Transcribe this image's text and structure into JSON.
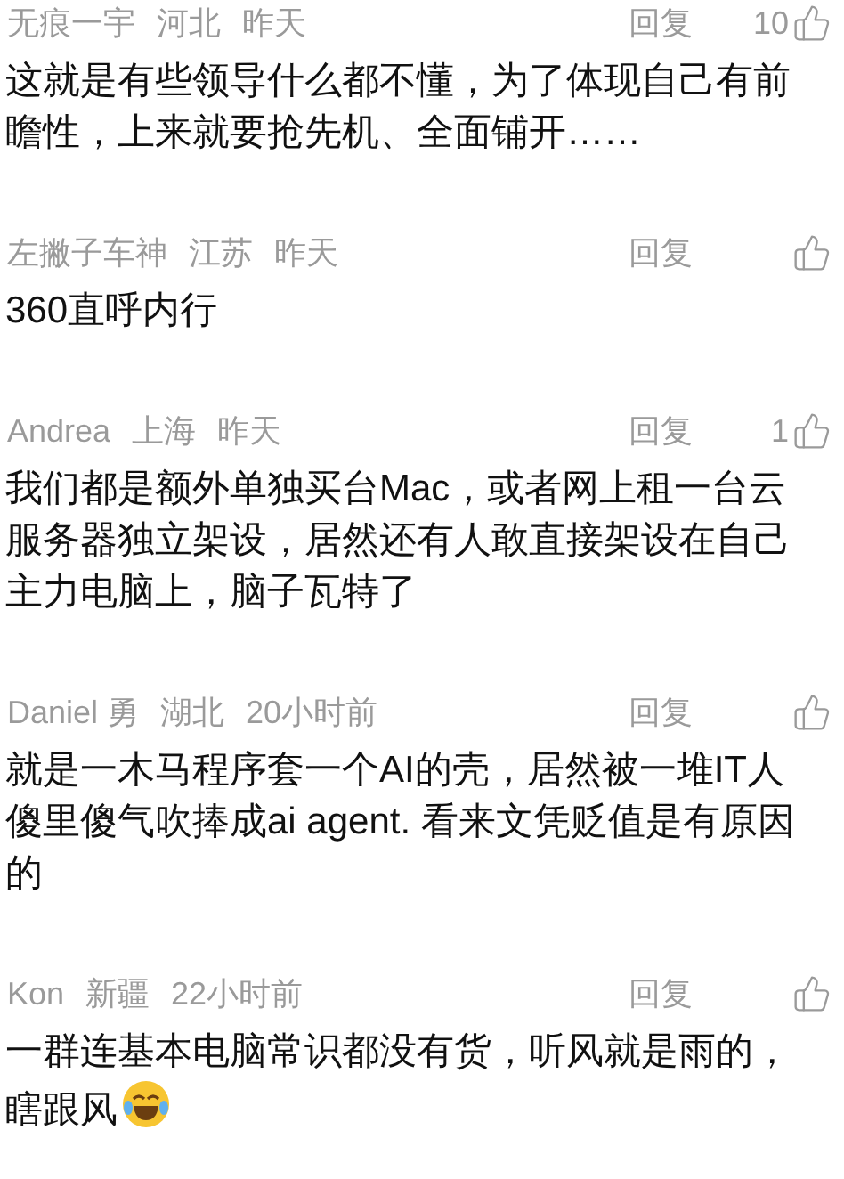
{
  "comments": [
    {
      "user": "无痕一宇",
      "region": "河北",
      "time": "昨天",
      "reply": "回复",
      "likes": "10",
      "text": "这就是有些领导什么都不懂，为了体现自己有前瞻性，上来就要抢先机、全面铺开……",
      "emoji": false
    },
    {
      "user": "左撇子车神",
      "region": "江苏",
      "time": "昨天",
      "reply": "回复",
      "text": "360直呼内行",
      "emoji": false
    },
    {
      "user": "Andrea",
      "region": "上海",
      "time": "昨天",
      "reply": "回复",
      "likes": "1",
      "text": "我们都是额外单独买台Mac，或者网上租一台云服务器独立架设，居然还有人敢直接架设在自己主力电脑上，脑子瓦特了",
      "emoji": false
    },
    {
      "user": "Daniel 勇",
      "region": "湖北",
      "time": "20小时前",
      "reply": "回复",
      "text": "就是一木马程序套一个AI的壳，居然被一堆IT人傻里傻气吹捧成ai agent. 看来文凭贬值是有原因的",
      "emoji": false
    },
    {
      "user": "Kon",
      "region": "新疆",
      "time": "22小时前",
      "reply": "回复",
      "text": "一群连基本电脑常识都没有货，听风就是雨的，瞎跟风",
      "emoji": true
    }
  ]
}
